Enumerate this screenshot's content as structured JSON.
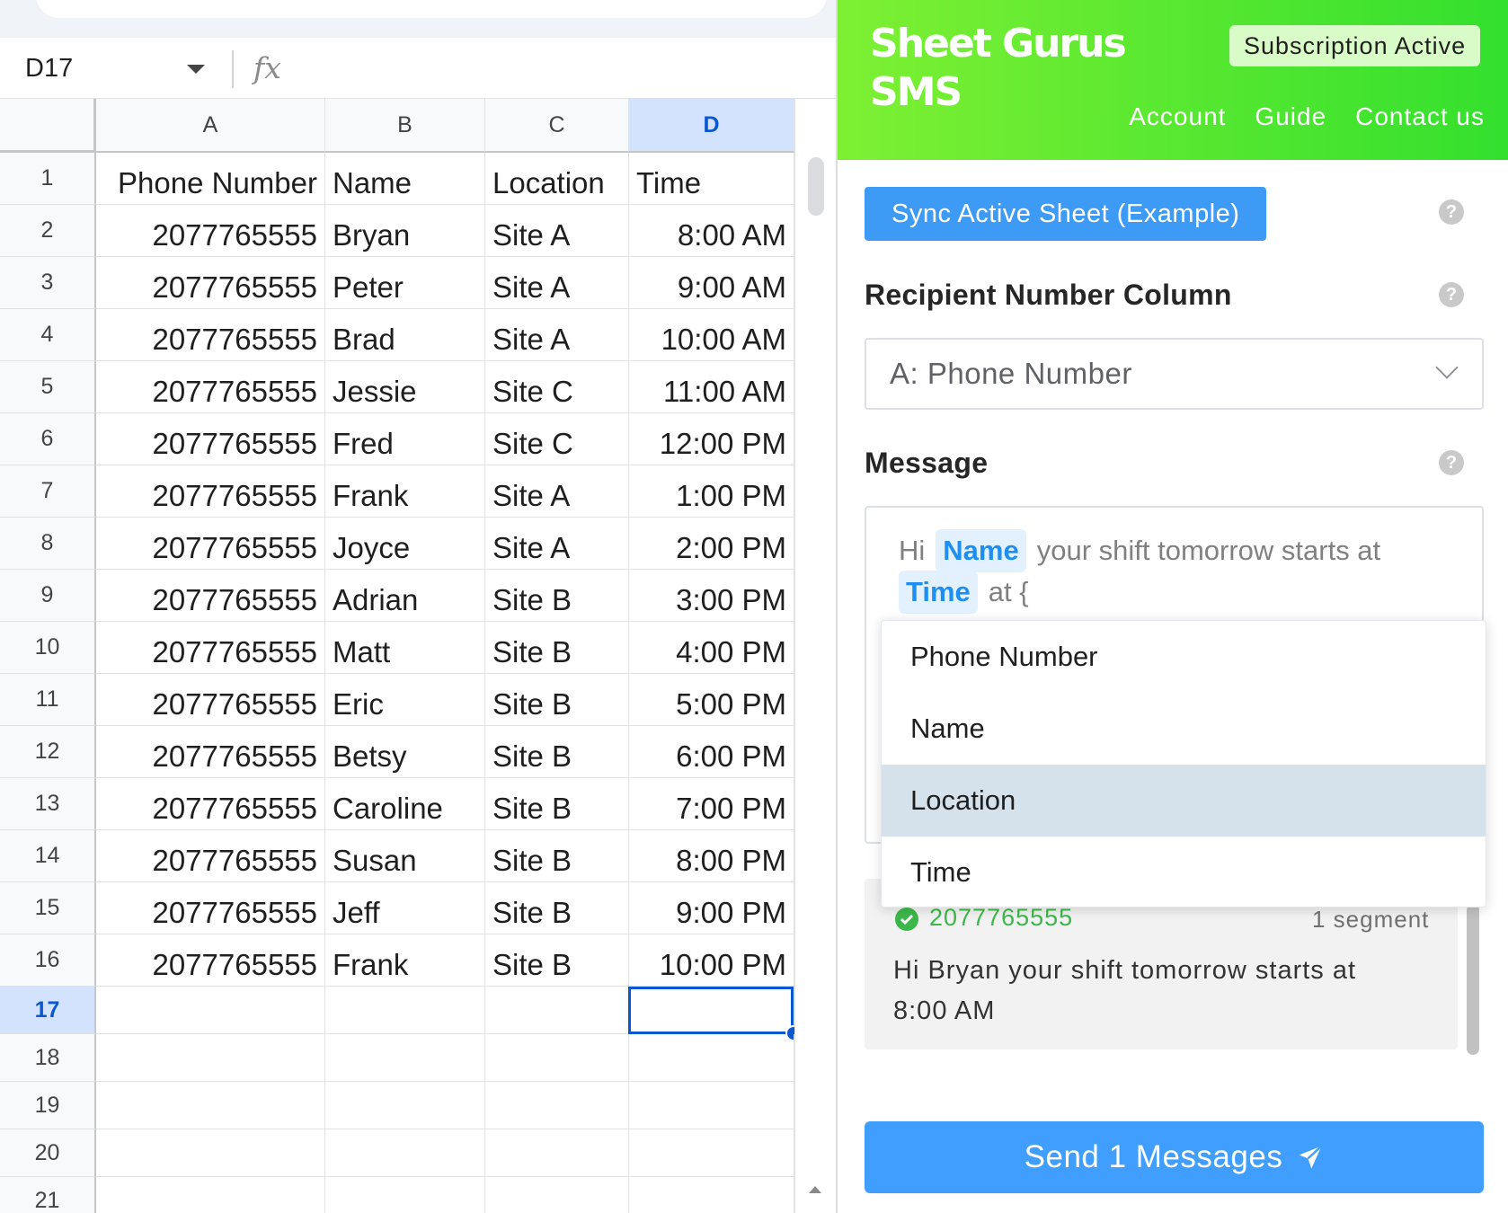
{
  "sheet": {
    "name_box": "D17",
    "fx_label": "fx",
    "columns": [
      "A",
      "B",
      "C",
      "D"
    ],
    "selected_cell": "D17",
    "header": [
      "Phone Number",
      "Name",
      "Location",
      "Time"
    ],
    "rows": [
      [
        "2077765555",
        "Bryan",
        "Site A",
        "8:00 AM"
      ],
      [
        "2077765555",
        "Peter",
        "Site A",
        "9:00 AM"
      ],
      [
        "2077765555",
        "Brad",
        "Site A",
        "10:00 AM"
      ],
      [
        "2077765555",
        "Jessie",
        "Site C",
        "11:00 AM"
      ],
      [
        "2077765555",
        "Fred",
        "Site C",
        "12:00 PM"
      ],
      [
        "2077765555",
        "Frank",
        "Site A",
        "1:00 PM"
      ],
      [
        "2077765555",
        "Joyce",
        "Site A",
        "2:00 PM"
      ],
      [
        "2077765555",
        "Adrian",
        "Site B",
        "3:00 PM"
      ],
      [
        "2077765555",
        "Matt",
        "Site B",
        "4:00 PM"
      ],
      [
        "2077765555",
        "Eric",
        "Site B",
        "5:00 PM"
      ],
      [
        "2077765555",
        "Betsy",
        "Site B",
        "6:00 PM"
      ],
      [
        "2077765555",
        "Caroline",
        "Site B",
        "7:00 PM"
      ],
      [
        "2077765555",
        "Susan",
        "Site B",
        "8:00 PM"
      ],
      [
        "2077765555",
        "Jeff",
        "Site B",
        "9:00 PM"
      ],
      [
        "2077765555",
        "Frank",
        "Site B",
        "10:00 PM"
      ]
    ],
    "row_numbers": [
      "1",
      "2",
      "3",
      "4",
      "5",
      "6",
      "7",
      "8",
      "9",
      "10",
      "11",
      "12",
      "13",
      "14",
      "15",
      "16",
      "17",
      "18",
      "19",
      "20",
      "21"
    ]
  },
  "panel": {
    "brand_line1": "Sheet Gurus",
    "brand_line2": "SMS",
    "subscription_badge": "Subscription Active",
    "nav": [
      "Account",
      "Guide",
      "Contact us"
    ],
    "sync_button": "Sync Active Sheet (Example)",
    "recipient_label": "Recipient Number Column",
    "recipient_value": "A: Phone Number",
    "message_label": "Message",
    "message": {
      "hi": "Hi",
      "tag_name": "Name",
      "middle": "your shift tomorrow starts at",
      "tag_time": "Time",
      "tail": "at {"
    },
    "dropdown_options": [
      "Phone Number",
      "Name",
      "Location",
      "Time"
    ],
    "dropdown_active": "Location",
    "preview": {
      "phone": "2077765555",
      "segments": "1 segment",
      "text": "Hi Bryan your shift tomorrow starts at 8:00 AM"
    },
    "send_button": "Send 1 Messages",
    "help_glyph": "?",
    "colors": {
      "brand_green_start": "#7ef033",
      "brand_green_end": "#33e02e",
      "primary_blue": "#409eff",
      "selection_blue": "#0b57d0"
    }
  }
}
